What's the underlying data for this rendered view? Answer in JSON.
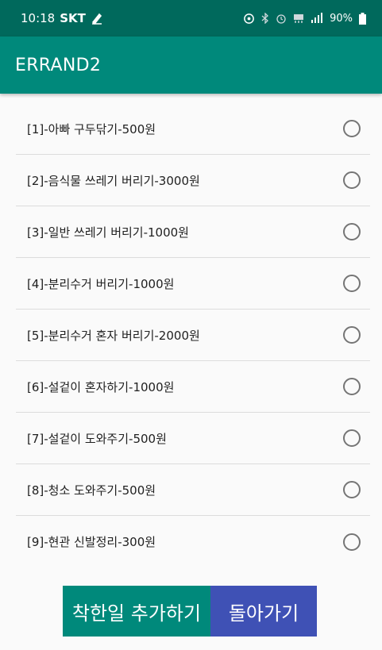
{
  "status_bar": {
    "time": "10:18",
    "carrier": "SKT",
    "battery": "90%",
    "icons": [
      "edit-hand-icon",
      "location-icon",
      "bluetooth-icon",
      "alarm-icon",
      "data-icon",
      "signal-icon",
      "battery-icon"
    ]
  },
  "app_bar": {
    "title": "ERRAND2"
  },
  "errands": [
    {
      "label": "[1]-아빠 구두닦기-500원",
      "checked": false
    },
    {
      "label": "[2]-음식물 쓰레기 버리기-3000원",
      "checked": false
    },
    {
      "label": "[3]-일반 쓰레기 버리기-1000원",
      "checked": false
    },
    {
      "label": "[4]-분리수거 버리기-1000원",
      "checked": false
    },
    {
      "label": "[5]-분리수거 혼자 버리기-2000원",
      "checked": false
    },
    {
      "label": "[6]-설겉이 혼자하기-1000원",
      "checked": false
    },
    {
      "label": "[7]-설겉이 도와주기-500원",
      "checked": false
    },
    {
      "label": "[8]-청소 도와주기-500원",
      "checked": false
    },
    {
      "label": "[9]-현관 신발정리-300원",
      "checked": false
    }
  ],
  "buttons": {
    "add_label": "착한일 추가하기",
    "back_label": "돌아가기"
  },
  "colors": {
    "status_bar": "#00695c",
    "app_bar": "#00897b",
    "add_button": "#00897b",
    "back_button": "#3f51b5"
  }
}
